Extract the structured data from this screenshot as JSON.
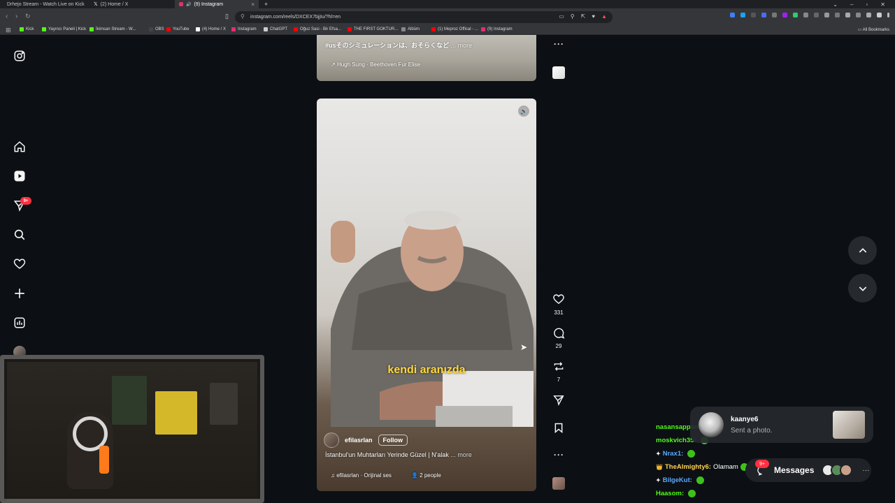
{
  "browser": {
    "tabs": [
      {
        "label": "Drhejo Stream - Watch Live on Kick",
        "color": "#53fc18"
      },
      {
        "label": "(2) Home / X",
        "color": "#ffffff"
      },
      {
        "label": "(9) Instagram",
        "color": "#e1306c"
      }
    ],
    "url": "instagram.com/reels/DXCEX7bjjIu/?hl=en",
    "bookmarks": [
      {
        "label": "Kick",
        "color": "#53fc18"
      },
      {
        "label": "Yayıncı Paneli | Kick",
        "color": "#53fc18"
      },
      {
        "label": "İkimsan Stream - W...",
        "color": "#53fc18"
      },
      {
        "label": "OBS",
        "color": "#444444"
      },
      {
        "label": "YouTube",
        "color": "#ff0000"
      },
      {
        "label": "(4) Home / X",
        "color": "#ffffff"
      },
      {
        "label": "Instagram",
        "color": "#e1306c"
      },
      {
        "label": "ChatGPT",
        "color": "#cccccc"
      },
      {
        "label": "Oğuz Sasi - Bir Efsa...",
        "color": "#ff0000"
      },
      {
        "label": "THE FIRST GOKTUR...",
        "color": "#ff0000"
      },
      {
        "label": "Albüm",
        "color": "#888888"
      },
      {
        "label": "(1) Meproz Offical - ...",
        "color": "#ff0000"
      },
      {
        "label": "(9) Instagram",
        "color": "#e1306c"
      }
    ],
    "all_bookmarks": "All Bookmarks"
  },
  "sidebar": {
    "notification_badge": "9+"
  },
  "reel_prev": {
    "caption": "#usそのシミュレーションは、おそらくなど",
    "more": "... more",
    "audio": "Hugh Sung · Beethoven Fur Elise"
  },
  "reel": {
    "subtitle": "kendi aranızda",
    "author": "efilasrlan",
    "follow": "Follow",
    "caption": "İstanbul'un Muhtarları Yerinde Güzel | N'alak",
    "more": "... more",
    "audio": "efilasrlan · Orijinal ses",
    "tagged": "2 people",
    "likes": "331",
    "comments": "29",
    "reposts": "7"
  },
  "chat": [
    {
      "name": "nasansappana:",
      "msg": "",
      "style": "green"
    },
    {
      "name": "moskvich35:",
      "msg": "",
      "style": "green"
    },
    {
      "name": "Nrax1:",
      "msg": "",
      "style": "blue"
    },
    {
      "name": "TheAlmighty6:",
      "msg": "Olamam",
      "style": "gold"
    },
    {
      "name": "BilgeKut:",
      "msg": "",
      "style": "blue"
    },
    {
      "name": "Haasom:",
      "msg": "",
      "style": "green"
    }
  ],
  "notification": {
    "user": "kaanye6",
    "text": "Sent a photo."
  },
  "messages": {
    "label": "Messages",
    "badge": "9+"
  }
}
